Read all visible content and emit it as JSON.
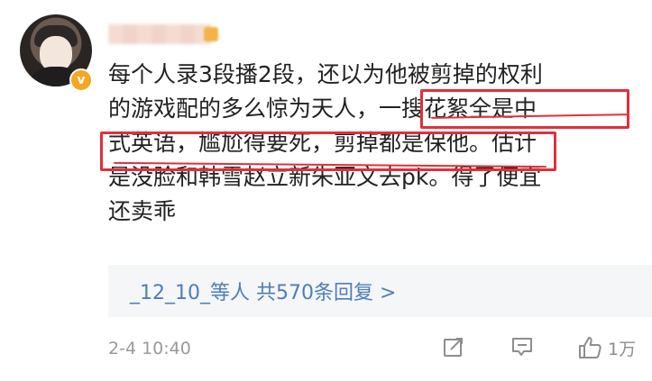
{
  "comment": {
    "username": "",
    "text_lines": [
      "每个人录3段播2段，还以为他被剪掉的权利",
      "的游戏配的多么惊为天人，一搜花絮全是中",
      "式英语，尴尬得要死，剪掉都是保他。估计",
      "是没脸和韩雪赵立新朱亚文去pk。得了便宜",
      "还卖乖"
    ],
    "verified_badge": "v"
  },
  "replies": {
    "summary": "_12_10_等人  共570条回复 >"
  },
  "footer": {
    "timestamp": "2-4 10:40",
    "like_count": "1万",
    "icons": [
      "share-icon",
      "comment-icon",
      "like-icon"
    ]
  },
  "colors": {
    "highlight": "#e0303a",
    "link": "#4d7fb5",
    "badge": "#f5a623"
  }
}
